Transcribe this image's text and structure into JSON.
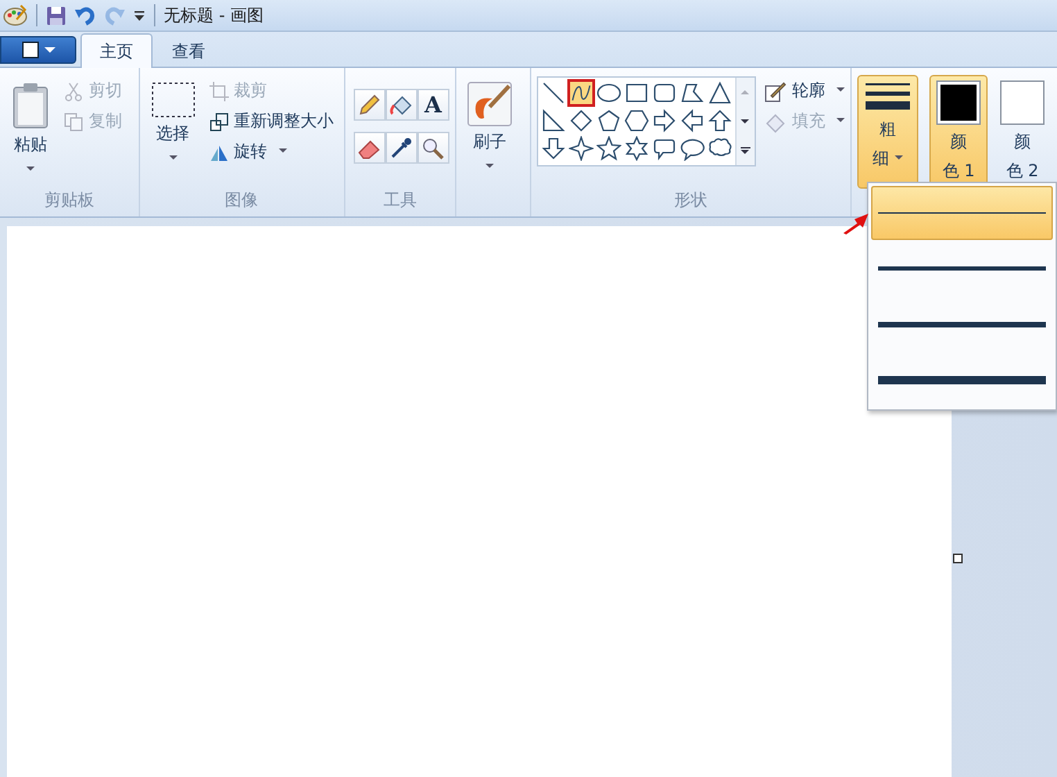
{
  "window": {
    "title": "无标题 - 画图"
  },
  "quick_access": [
    {
      "kind": "save",
      "disabled": false
    },
    {
      "kind": "undo",
      "disabled": false
    },
    {
      "kind": "redo",
      "disabled": true
    }
  ],
  "tabs": [
    {
      "label": "主页",
      "selected": true
    },
    {
      "label": "查看",
      "selected": false
    }
  ],
  "clipboard": {
    "paste": "粘贴",
    "items": [
      {
        "label": "剪切",
        "kind": "cut",
        "disabled": true
      },
      {
        "label": "复制",
        "kind": "copy",
        "disabled": true
      }
    ],
    "group": "剪贴板"
  },
  "image": {
    "select": "选择",
    "items": [
      {
        "label": "裁剪",
        "kind": "crop",
        "disabled": true
      },
      {
        "label": "重新调整大小",
        "kind": "resize",
        "disabled": false
      },
      {
        "label": "旋转",
        "kind": "rotate",
        "disabled": false
      }
    ],
    "group": "图像"
  },
  "tools": {
    "items": [
      {
        "kind": "pencil"
      },
      {
        "kind": "fill"
      },
      {
        "kind": "text",
        "glyph": "A"
      },
      {
        "kind": "eraser"
      },
      {
        "kind": "picker"
      },
      {
        "kind": "magnifier"
      }
    ],
    "group": "工具"
  },
  "brushes": {
    "label": "刷子"
  },
  "shapes": {
    "items": [
      {
        "kind": "line",
        "selected": false
      },
      {
        "kind": "curve",
        "selected": true
      },
      {
        "kind": "oval",
        "selected": false
      },
      {
        "kind": "rect",
        "selected": false
      },
      {
        "kind": "roundrect",
        "selected": false
      },
      {
        "kind": "polygon",
        "selected": false
      },
      {
        "kind": "triangle",
        "selected": false
      },
      {
        "kind": "righttriangle",
        "selected": false
      },
      {
        "kind": "diamond",
        "selected": false
      },
      {
        "kind": "pentagon",
        "selected": false
      },
      {
        "kind": "hexagon",
        "selected": false
      },
      {
        "kind": "rightarrow",
        "selected": false
      },
      {
        "kind": "leftarrow",
        "selected": false
      },
      {
        "kind": "uparrow",
        "selected": false
      },
      {
        "kind": "downarrow",
        "selected": false
      },
      {
        "kind": "star4",
        "selected": false
      },
      {
        "kind": "star5",
        "selected": false
      },
      {
        "kind": "star6",
        "selected": false
      },
      {
        "kind": "roundcallout",
        "selected": false
      },
      {
        "kind": "ovalcallout",
        "selected": false
      },
      {
        "kind": "cloudcallout",
        "selected": false
      }
    ],
    "outline": {
      "label": "轮廓",
      "disabled": false
    },
    "fill": {
      "label": "填充",
      "disabled": true
    },
    "group": "形状"
  },
  "size": {
    "label_1": "粗",
    "label_2": "细",
    "open": true,
    "options": [
      {
        "kind": "hairline",
        "selected": true
      },
      {
        "kind": "thin",
        "selected": false
      },
      {
        "kind": "medium",
        "selected": false
      },
      {
        "kind": "thick",
        "selected": false
      }
    ]
  },
  "colors": [
    {
      "label_1": "颜",
      "label_2": "色 1",
      "color": "#000000",
      "selected": true
    },
    {
      "label_1": "颜",
      "label_2": "色 2",
      "color": "#ffffff",
      "selected": false
    }
  ]
}
